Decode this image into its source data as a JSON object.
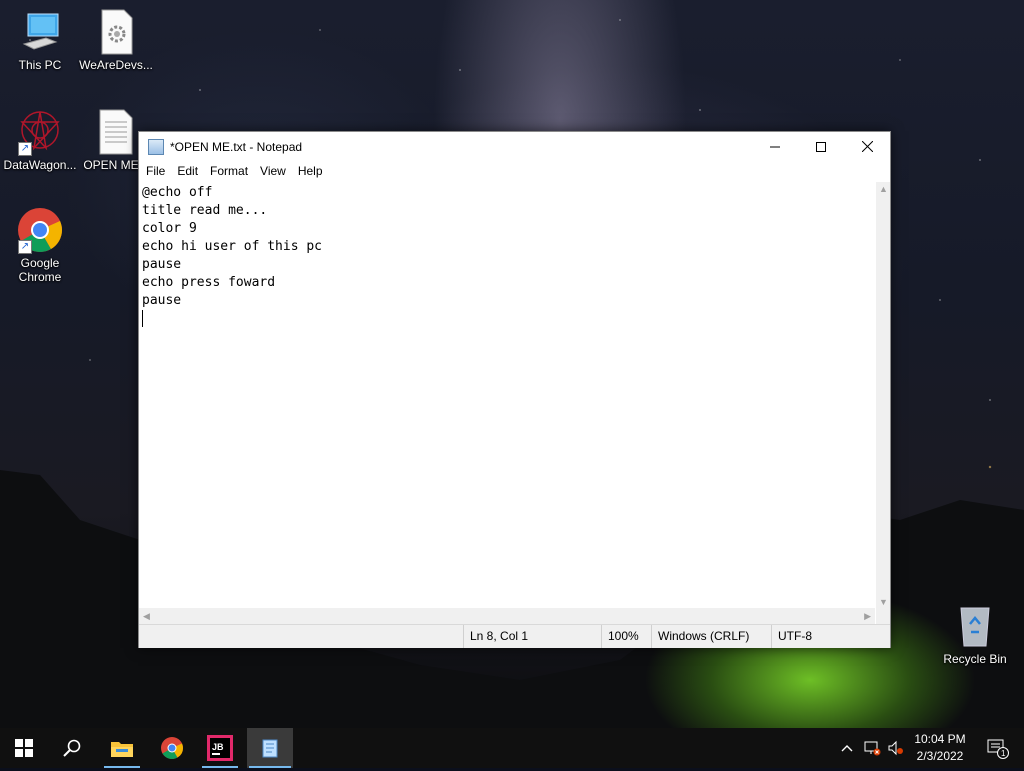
{
  "desktop": {
    "icons": [
      {
        "label": "This PC",
        "icon": "computer-icon"
      },
      {
        "label": "WeAreDevs...",
        "icon": "settings-file-icon"
      },
      {
        "label": "DataWagon...",
        "icon": "datawagon-shortcut-icon"
      },
      {
        "label": "OPEN ME...",
        "icon": "text-file-icon"
      },
      {
        "label": "Google Chrome",
        "icon": "chrome-icon"
      },
      {
        "label": "Recycle Bin",
        "icon": "recycle-bin-icon"
      }
    ]
  },
  "notepad": {
    "title": "*OPEN ME.txt - Notepad",
    "menu": [
      "File",
      "Edit",
      "Format",
      "View",
      "Help"
    ],
    "content": "@echo off\ntitle read me...\ncolor 9\necho hi user of this pc\npause\necho press foward\npause",
    "status": {
      "position": "Ln 8, Col 1",
      "zoom": "100%",
      "line_ending": "Windows (CRLF)",
      "encoding": "UTF-8"
    }
  },
  "taskbar": {
    "start_icon": "windows-start-icon",
    "search_icon": "search-icon",
    "apps": [
      {
        "name": "file-explorer",
        "icon": "folder-icon",
        "open": true
      },
      {
        "name": "chrome",
        "icon": "chrome-icon",
        "open": false
      },
      {
        "name": "jetbrains",
        "icon": "jetbrains-icon",
        "open": true
      },
      {
        "name": "notepad",
        "icon": "notepad-icon",
        "open": true,
        "active": true
      }
    ],
    "clock": {
      "time": "10:04 PM",
      "date": "2/3/2022"
    },
    "notification_count": "1"
  },
  "colors": {
    "accent": "#76b9ed",
    "taskbar": "#101010",
    "tent_green": "#78d228"
  }
}
